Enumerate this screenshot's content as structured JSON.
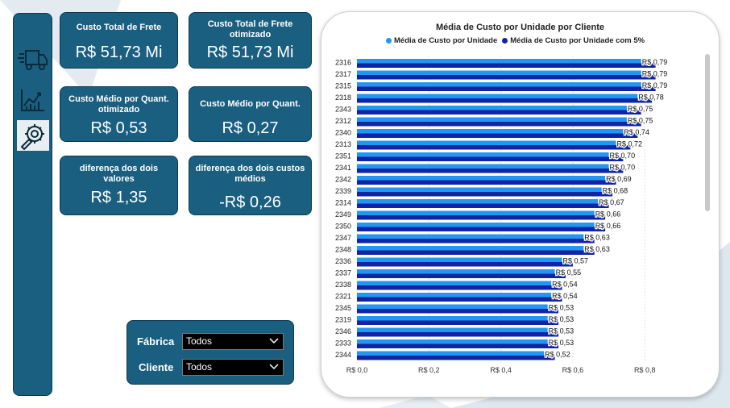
{
  "cards": {
    "custo_total_frete": {
      "label": "Custo Total de Frete",
      "value": "R$ 51,73 Mi"
    },
    "custo_total_frete_otimizado": {
      "label": "Custo Total de Frete otimizado",
      "value": "R$ 51,73 Mi"
    },
    "custo_medio_otimizado": {
      "label": "Custo Médio por Quant. otimizado",
      "value": "R$ 0,53"
    },
    "custo_medio": {
      "label": "Custo Médio por Quant.",
      "value": "R$ 0,27"
    },
    "diferenca_valores": {
      "label": "diferença dos dois valores",
      "value": "R$ 1,35"
    },
    "diferenca_custos_medios": {
      "label": "diferença dos dois custos médios",
      "value": "-R$ 0,26"
    }
  },
  "filters": {
    "fabrica": {
      "label": "Fábrica",
      "selected": "Todos"
    },
    "cliente": {
      "label": "Cliente",
      "selected": "Todos"
    }
  },
  "nav": {
    "items": [
      {
        "icon": "truck-icon",
        "active": false
      },
      {
        "icon": "line-chart-icon",
        "active": false
      },
      {
        "icon": "optimization-gear-icon",
        "active": true
      }
    ]
  },
  "colors": {
    "panel": "#1a5e80",
    "series1": "#2196f3",
    "series2": "#1224a6"
  },
  "chart_data": {
    "type": "bar",
    "orientation": "horizontal",
    "title": "Média de Custo por Unidade por Cliente",
    "categories": [
      "2316",
      "2317",
      "2315",
      "2318",
      "2343",
      "2312",
      "2340",
      "2313",
      "2351",
      "2341",
      "2342",
      "2339",
      "2314",
      "2349",
      "2350",
      "2347",
      "2348",
      "2336",
      "2337",
      "2338",
      "2321",
      "2345",
      "2319",
      "2346",
      "2333",
      "2344"
    ],
    "series": [
      {
        "name": "Média de Custo por Unidade",
        "color": "#2196f3",
        "values": [
          0.79,
          0.79,
          0.79,
          0.78,
          0.75,
          0.75,
          0.74,
          0.72,
          0.7,
          0.7,
          0.69,
          0.68,
          0.67,
          0.66,
          0.66,
          0.63,
          0.63,
          0.57,
          0.55,
          0.54,
          0.54,
          0.53,
          0.53,
          0.53,
          0.53,
          0.52
        ]
      },
      {
        "name": "Média de Custo por Unidade com 5%",
        "color": "#1224a6",
        "values": [
          0.83,
          0.83,
          0.83,
          0.82,
          0.79,
          0.79,
          0.78,
          0.76,
          0.74,
          0.74,
          0.72,
          0.71,
          0.7,
          0.69,
          0.69,
          0.66,
          0.66,
          0.6,
          0.58,
          0.57,
          0.57,
          0.56,
          0.56,
          0.56,
          0.56,
          0.55
        ]
      }
    ],
    "data_labels": [
      "R$ 0,79",
      "R$ 0,79",
      "R$ 0,79",
      "R$ 0,78",
      "R$ 0,75",
      "R$ 0,75",
      "R$ 0,74",
      "R$ 0,72",
      "R$ 0,70",
      "R$ 0,70",
      "R$ 0,69",
      "R$ 0,68",
      "R$ 0,67",
      "R$ 0,66",
      "R$ 0,66",
      "R$ 0,63",
      "R$ 0,63",
      "R$ 0,57",
      "R$ 0,55",
      "R$ 0,54",
      "R$ 0,54",
      "R$ 0,53",
      "R$ 0,53",
      "R$ 0,53",
      "R$ 0,53",
      "R$ 0,52"
    ],
    "x_ticks": [
      "R$ 0,0",
      "R$ 0,2",
      "R$ 0,4",
      "R$ 0,6",
      "R$ 0,8"
    ],
    "x_tick_values": [
      0,
      0.2,
      0.4,
      0.6,
      0.8
    ],
    "xlim": [
      0,
      0.86
    ],
    "legend": "top-center",
    "grid": true
  }
}
